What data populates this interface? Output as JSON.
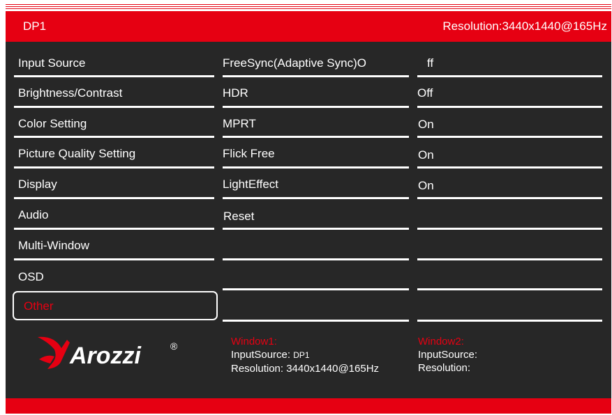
{
  "header": {
    "input_source": "DP1",
    "resolution": "Resolution:3440x1440@165Hz"
  },
  "menu": {
    "items": [
      {
        "label": "Input Source"
      },
      {
        "label": "Brightness/Contrast"
      },
      {
        "label": "Color Setting"
      },
      {
        "label": "Picture Quality Setting"
      },
      {
        "label": "Display"
      },
      {
        "label": "Audio"
      },
      {
        "label": "Multi-Window"
      },
      {
        "label": "OSD"
      },
      {
        "label": "Other"
      }
    ],
    "selected": "Other"
  },
  "submenu": {
    "items": [
      {
        "label": "FreeSync(Adaptive Sync)O",
        "value": "ff"
      },
      {
        "label": "HDR",
        "value": "Off"
      },
      {
        "label": "MPRT",
        "value": "On"
      },
      {
        "label": "Flick Free",
        "value": "On"
      },
      {
        "label": "LightEffect",
        "value": "On"
      },
      {
        "label": "Reset",
        "value": ""
      }
    ]
  },
  "logo": {
    "brand": "Arozzi",
    "registered": "®"
  },
  "window1": {
    "title": "Window1:",
    "input_label": "InputSource:",
    "input_value": "DP1",
    "resolution_label": "Resolution:",
    "resolution_value": "3440x1440@165Hz"
  },
  "window2": {
    "title": "Window2:",
    "input_label": "InputSource:",
    "resolution_label": "Resolution:"
  },
  "colors": {
    "accent": "#e60012",
    "panel": "#272727",
    "text": "#ffffff"
  }
}
